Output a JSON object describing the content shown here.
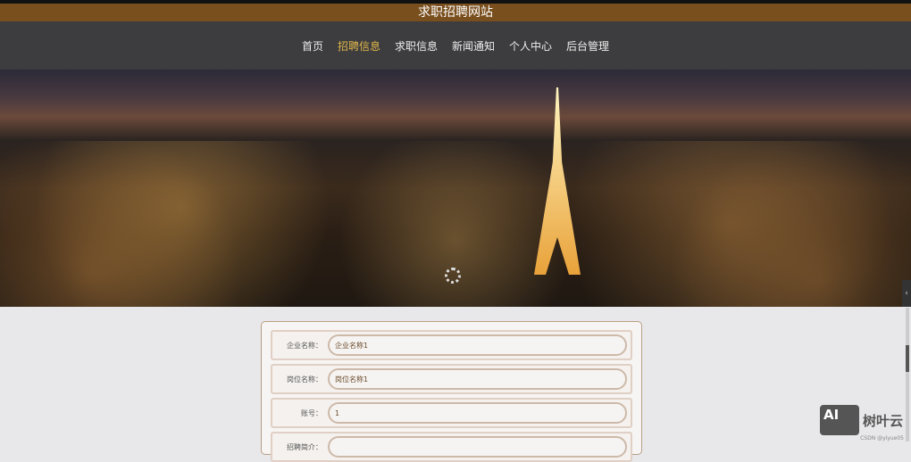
{
  "site_title": "求职招聘网站",
  "nav": [
    {
      "label": "首页"
    },
    {
      "label": "招聘信息",
      "active": true
    },
    {
      "label": "求职信息"
    },
    {
      "label": "新闻通知"
    },
    {
      "label": "个人中心"
    },
    {
      "label": "后台管理"
    }
  ],
  "form": {
    "rows": [
      {
        "label": "企业名称：",
        "value": "企业名称1"
      },
      {
        "label": "岗位名称：",
        "value": "岗位名称1"
      },
      {
        "label": "账号：",
        "value": "1"
      },
      {
        "label": "招聘简介：",
        "value": ""
      }
    ]
  },
  "watermark": {
    "logo": "AI",
    "brand": "树叶云",
    "credit": "CSDN @yiyue05"
  },
  "colors": {
    "title_bar": "#7a4f1e",
    "nav_bg": "#3d3d3f",
    "nav_active": "#e0b64a"
  }
}
